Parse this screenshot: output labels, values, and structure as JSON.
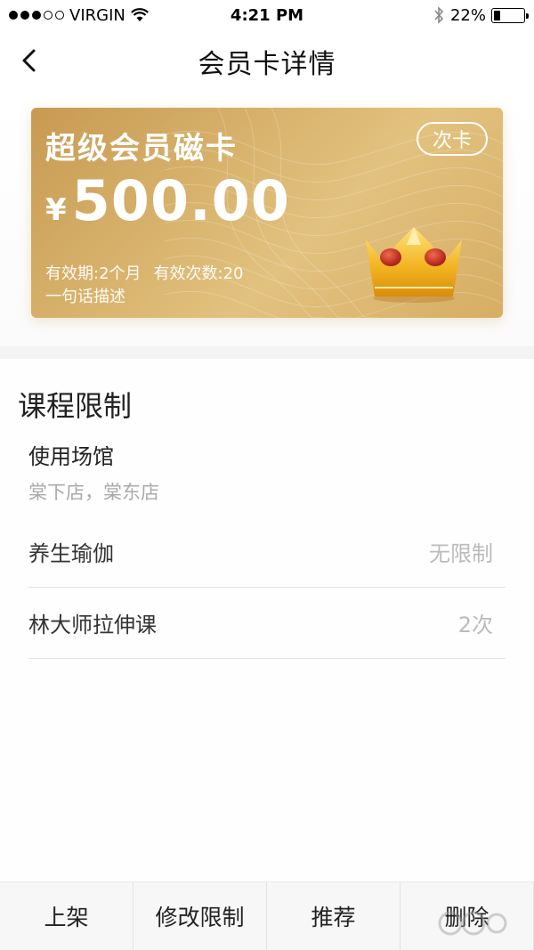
{
  "status_bar": {
    "carrier": "VIRGIN",
    "time": "4:21 PM",
    "battery": "22%",
    "battery_level": 0.22,
    "icons": [
      "signal-dots-icon",
      "wifi-icon",
      "bluetooth-icon",
      "battery-icon"
    ]
  },
  "nav": {
    "title": "会员卡详情",
    "back_icon": "chevron-left-icon"
  },
  "card": {
    "name": "超级会员磁卡",
    "type_badge": "次卡",
    "currency": "¥",
    "price": "500.00",
    "validity": "有效期:2个月",
    "times": "有效次数:20",
    "description": "一句话描述",
    "colors": {
      "gold_start": "#c89a52",
      "gold_end": "#e2c27f"
    },
    "emblem": "crown-icon"
  },
  "restrictions": {
    "title": "课程限制",
    "venue_label": "使用场馆",
    "venue_value": "棠下店，棠东店",
    "courses": [
      {
        "name": "养生瑜伽",
        "limit": "无限制"
      },
      {
        "name": "林大师拉伸课",
        "limit": "2次"
      }
    ]
  },
  "toolbar": {
    "buttons": [
      "上架",
      "修改限制",
      "推荐",
      "删除"
    ]
  }
}
